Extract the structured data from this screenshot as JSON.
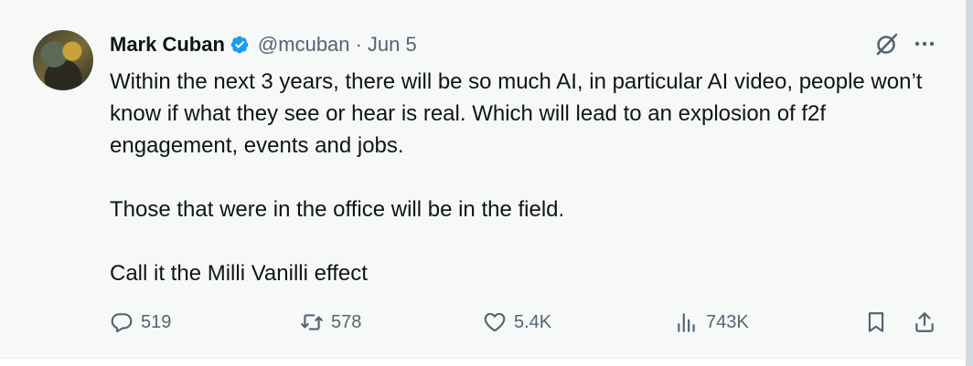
{
  "author": {
    "name": "Mark Cuban",
    "handle": "@mcuban",
    "separator": "·",
    "date": "Jun 5"
  },
  "tweet": {
    "paragraphs": [
      "Within the next 3 years, there will be so much AI, in particular AI video, people won’t know if what they see or hear is real.  Which will lead to an explosion of f2f engagement, events and jobs.",
      "Those that were in the office will be in the field.",
      "Call it the Milli Vanilli effect"
    ]
  },
  "actions": {
    "replies": "519",
    "reposts": "578",
    "likes": "5.4K",
    "views": "743K"
  },
  "icons": {
    "verified": "verified-badge-icon",
    "grok": "grok-icon",
    "more": "more-icon",
    "reply": "reply-icon",
    "repost": "repost-icon",
    "like": "heart-icon",
    "views": "views-icon",
    "bookmark": "bookmark-icon",
    "share": "share-icon"
  },
  "colors": {
    "text": "#0f1419",
    "secondary": "#536471",
    "verified": "#1d9bf0",
    "background": "#f7f9f9"
  }
}
